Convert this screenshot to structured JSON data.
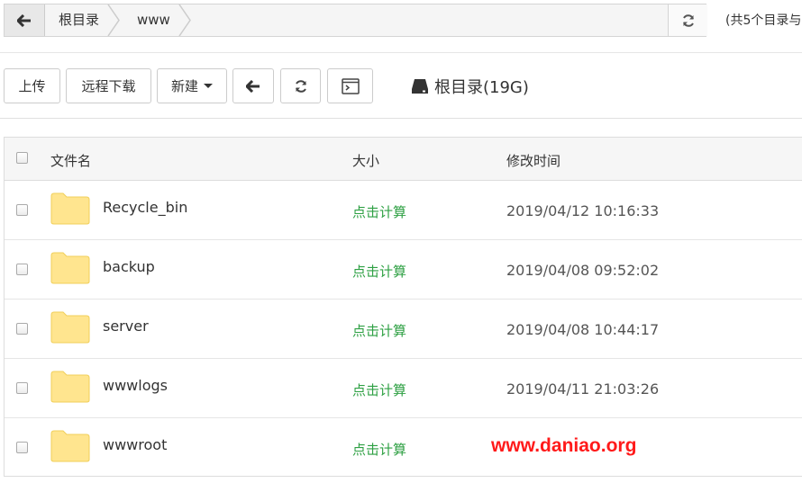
{
  "breadcrumb": {
    "items": [
      "根目录",
      "www"
    ],
    "summary": "(共5个目录与"
  },
  "toolbar": {
    "upload": "上传",
    "remote_download": "远程下载",
    "new": "新建",
    "disk": "根目录(19G)"
  },
  "table": {
    "headers": {
      "name": "文件名",
      "size": "大小",
      "modified": "修改时间"
    },
    "rows": [
      {
        "name": "Recycle_bin",
        "size": "点击计算",
        "modified": "2019/04/12 10:16:33"
      },
      {
        "name": "backup",
        "size": "点击计算",
        "modified": "2019/04/08 09:52:02"
      },
      {
        "name": "server",
        "size": "点击计算",
        "modified": "2019/04/08 10:44:17"
      },
      {
        "name": "wwwlogs",
        "size": "点击计算",
        "modified": "2019/04/11 21:03:26"
      },
      {
        "name": "wwwroot",
        "size": "点击计算",
        "modified": ""
      }
    ]
  },
  "watermark": "www.daniao.org",
  "colors": {
    "size_link": "#2ea043",
    "folder": "#ffe58f",
    "watermark": "#ff1a1a"
  }
}
